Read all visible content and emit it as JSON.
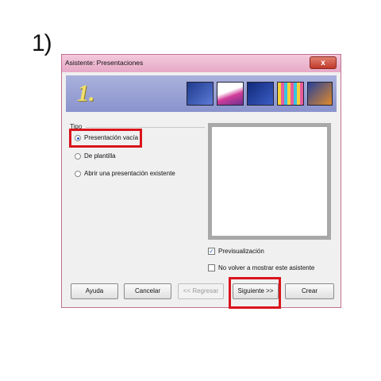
{
  "step_label": "1)",
  "window": {
    "title": "Asistente: Presentaciones",
    "close_glyph": "x",
    "banner_number": "1."
  },
  "type_group": {
    "label": "Tipo",
    "options": [
      {
        "label": "Presentación vacía",
        "selected": true
      },
      {
        "label": "De plantilla",
        "selected": false
      },
      {
        "label": "Abrir una presentación existente",
        "selected": false
      }
    ]
  },
  "checks": {
    "preview": {
      "label": "Previsualización",
      "checked": true
    },
    "no_show": {
      "label": "No volver a mostrar este asistente",
      "checked": false
    }
  },
  "buttons": {
    "help": "Ayuda",
    "cancel": "Cancelar",
    "back": "<< Regresar",
    "next": "Siguiente >>",
    "create": "Crear"
  },
  "colors": {
    "highlight": "#d9141d",
    "banner": "#8a93cd",
    "titlebar": "#e7a9c6"
  }
}
